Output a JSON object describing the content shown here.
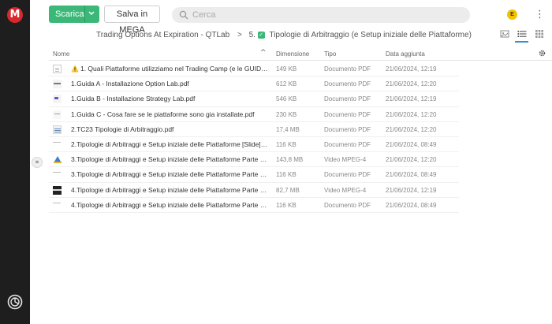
{
  "app": {
    "logo_letter": "M"
  },
  "toolbar": {
    "download_label": "Scarica",
    "save_label": "Salva in MEGA",
    "search_placeholder": "Cerca",
    "avatar_initial": "E",
    "more_glyph": "⋮"
  },
  "breadcrumb": {
    "parent": "Trading Options At Expiration - QTLab",
    "separator": ">",
    "current_prefix": "5.",
    "current": "Tipologie di Arbitraggio (e Setup iniziale delle Piattaforme)"
  },
  "views": {
    "active": "list",
    "options": [
      "thumbnail",
      "list",
      "grid"
    ]
  },
  "table": {
    "headers": {
      "name": "Nome",
      "size": "Dimensione",
      "type": "Tipo",
      "date": "Data aggiunta"
    },
    "sort": {
      "column": "name",
      "glyph": "^"
    },
    "rows": [
      {
        "icon": "doc-icon",
        "warning": "⚠️",
        "name": "1. Quali Piattaforme utilizziamo nel Trading Camp (e le GUIDE p...",
        "size": "149 KB",
        "type": "Documento PDF",
        "date": "21/06/2024, 12:19"
      },
      {
        "icon": "pdf-thumbnail-icon",
        "name": "1.Guida A - Installazione Option Lab.pdf",
        "size": "612 KB",
        "type": "Documento PDF",
        "date": "21/06/2024, 12:20"
      },
      {
        "icon": "pdf-thumbnail-icon",
        "name": "1.Guida B - Installazione Strategy Lab.pdf",
        "size": "546 KB",
        "type": "Documento PDF",
        "date": "21/06/2024, 12:19"
      },
      {
        "icon": "pdf-thumbnail-icon",
        "name": "1.Guida C - Cosa fare se le piattaforme sono gia installate.pdf",
        "size": "230 KB",
        "type": "Documento PDF",
        "date": "21/06/2024, 12:20"
      },
      {
        "icon": "pdf-thumbnail-icon",
        "name": "2.TC23 Tipologie di Arbitraggio.pdf",
        "size": "17,4 MB",
        "type": "Documento PDF",
        "date": "21/06/2024, 12:20"
      },
      {
        "icon": "pdf-thumbnail-icon",
        "name": "2.Tipologie di Arbitraggi e Setup iniziale delle Piattaforme [Slide].pdf",
        "size": "116 KB",
        "type": "Documento PDF",
        "date": "21/06/2024, 08:49"
      },
      {
        "icon": "video-thumbnail-icon",
        "name": "3.Tipologie di Arbitraggi e Setup iniziale delle Piattaforme Parte 1 [...",
        "size": "143,8 MB",
        "type": "Video MPEG-4",
        "date": "21/06/2024, 12:20"
      },
      {
        "icon": "pdf-thumbnail-icon",
        "name": "3.Tipologie di Arbitraggi e Setup iniziale delle Piattaforme Parte 1 [...",
        "size": "116 KB",
        "type": "Documento PDF",
        "date": "21/06/2024, 08:49"
      },
      {
        "icon": "video-thumbnail-icon",
        "name": "4.Tipologie di Arbitraggi e Setup iniziale delle Piattaforme Parte 2 [...",
        "size": "82,7 MB",
        "type": "Video MPEG-4",
        "date": "21/06/2024, 12:19"
      },
      {
        "icon": "pdf-thumbnail-icon",
        "name": "4.Tipologie di Arbitraggi e Setup iniziale delle Piattaforme Parte 2 [...",
        "size": "116 KB",
        "type": "Documento PDF",
        "date": "21/06/2024, 08:49"
      }
    ]
  },
  "sidebar": {
    "expand_glyph": "»"
  },
  "colors": {
    "accent_green": "#3bb877",
    "mega_red": "#d9272e",
    "sidebar_bg": "#1e1e1e",
    "active_view_blue": "#3a8fd6"
  }
}
